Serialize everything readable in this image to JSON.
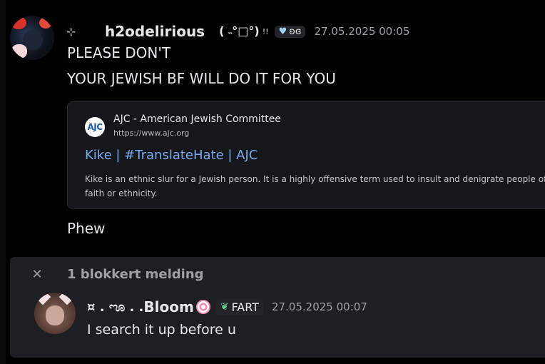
{
  "message1": {
    "prefix_symbol": "⊹",
    "username": "h2odelirious",
    "kaomoji": "( ˵°□°)",
    "exclaim": "!!",
    "tag_text": "ʚɞ",
    "timestamp": "27.05.2025 00:05",
    "lines": [
      "PLEASE DON'T",
      "YOUR JEWISH BF WILL DO IT FOR YOU"
    ],
    "embed": {
      "icon_text": "AJC",
      "provider": "AJC - American Jewish Committee",
      "url": "https://www.ajc.org",
      "title": "Kike | #TranslateHate | AJC",
      "description": "Kike is an ethnic slur for a Jewish person. It is a highly offensive term used to insult and denigrate people of Jewish faith or ethnicity."
    },
    "followup": "Phew"
  },
  "blocked": {
    "label": "1 blokkert melding",
    "message": {
      "name_prefix": "¤ . ೡ .  .",
      "username": "Bloom",
      "tag_text": "FART",
      "timestamp": "27.05.2025 00:07",
      "text": "I search it up before u"
    }
  },
  "colors": {
    "background": "#000000",
    "link": "#7aa8f0",
    "muted": "#9ea0a6",
    "panel": "#1e1f22"
  }
}
